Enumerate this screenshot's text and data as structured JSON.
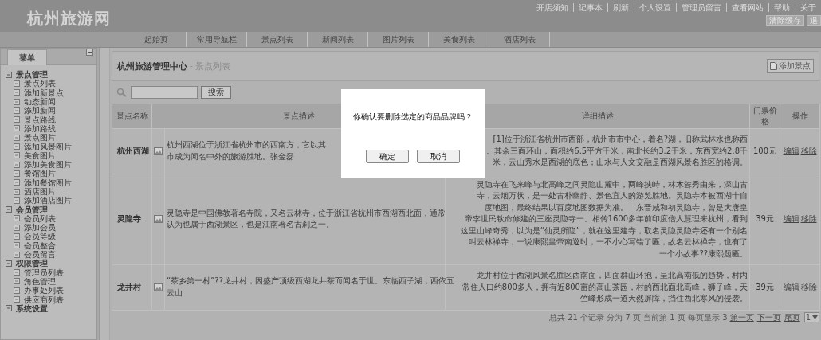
{
  "site": {
    "logo": "杭州旅游网"
  },
  "top_links": [
    "开店须知",
    "记事本",
    "刷新",
    "个人设置",
    "管理员留言",
    "查看网站",
    "帮助",
    "关于"
  ],
  "top_buttons": [
    "清除缓存",
    "退"
  ],
  "nav_tabs": [
    "起始页",
    "常用导航栏",
    "景点列表",
    "新闻列表",
    "图片列表",
    "美食列表",
    "酒店列表"
  ],
  "sidebar": {
    "tab": "菜单",
    "groups": [
      {
        "label": "景点管理",
        "expanded": true,
        "children": [
          {
            "label": "景点列表"
          },
          {
            "label": "添加新景点"
          },
          {
            "label": "动态新闻"
          },
          {
            "label": "添加新闻"
          },
          {
            "label": "景点路线"
          },
          {
            "label": "添加路线"
          },
          {
            "label": "景点图片"
          },
          {
            "label": "添加风景图片"
          },
          {
            "label": "美食图片"
          },
          {
            "label": "添加美食图片"
          },
          {
            "label": "餐馆图片"
          },
          {
            "label": "添加餐馆图片"
          },
          {
            "label": "酒店图片"
          },
          {
            "label": "添加酒店图片"
          }
        ]
      },
      {
        "label": "会员管理",
        "expanded": true,
        "children": [
          {
            "label": "会员列表"
          },
          {
            "label": "添加会员"
          },
          {
            "label": "会员等级"
          },
          {
            "label": "会员整合"
          },
          {
            "label": "会员留言"
          }
        ]
      },
      {
        "label": "权限管理",
        "expanded": true,
        "children": [
          {
            "label": "管理员列表"
          },
          {
            "label": "角色管理"
          },
          {
            "label": "办事处列表"
          },
          {
            "label": "供应商列表"
          }
        ]
      },
      {
        "label": "系统设置",
        "expanded": true
      }
    ]
  },
  "breadcrumb": {
    "title": "杭州旅游管理中心",
    "separator": "-",
    "current": "景点列表"
  },
  "add_button": "添加景点",
  "search": {
    "button": "搜索"
  },
  "table": {
    "columns": [
      "景点名称",
      "景点描述",
      "详细描述",
      "门票价格",
      "操作"
    ],
    "rows": [
      {
        "name": "杭州西湖",
        "description": [
          "杭州西湖位于浙江省杭州市的西南方，它以其",
          "市成为闻名中外的旅游胜地。张金磊"
        ],
        "details": [
          "[1]位于浙江省杭州市西部，杭州市市中心，着名?湖，旧称武林水也称西",
          "。其余三面环山，面积约6.5平方千米，南北长约3.2千米，东西宽约2.8千",
          "米，云山秀水是西湖的底色；山水与人文交融是西湖风景名胜区的格调。"
        ],
        "price": "100元",
        "actions": [
          "编辑",
          "移除"
        ]
      },
      {
        "name": "灵隐寺",
        "description": [
          "灵隐寺是中国佛教著名寺院，又名云林寺，位于浙江省杭州市西湖西北面，通常",
          "认为也属于西湖景区，也是江南著名古刹之一。"
        ],
        "details": [
          "灵隐寺在飞来峰与北高峰之间灵隐山麓中，两峰挟峙，林木耸秀由来，深山古",
          "寺，云烟万状，是一处古朴幽静、景色宜人的游览胜地。灵隐寺本被西湖十自",
          "度地图，最终结果以百度地图数据为准。　东晋咸和初灵隐寺，曾是大唐皇",
          "帝李世民钦命修建的三座灵隐寺一。相传1600多年前印度僧人慧理来杭州，看到",
          "这里山峰奇秀，以为是“仙灵所隐”，就在这里建寺，取名灵隐灵隐寺还有一个别名",
          "叫云林禅寺，一说康熙皇帝南巡时，一不小心写错了匾，故名云林禅寺，也有了",
          "一个小故事??康熙题匾。"
        ],
        "price": "39元",
        "actions": [
          "编辑",
          "移除"
        ]
      },
      {
        "name": "龙井村",
        "description": [
          "“茶乡第一村”??龙井村，因盛产顶级西湖龙井茶而闻名于世。东临西子湖，西依五",
          "云山"
        ],
        "details": [
          "龙井村位于西湖风景名胜区西南面，四面群山环抱，呈北高南低的趋势，村内",
          "常住人口约800多人，拥有近800亩的高山茶园，村的西北面北高峰，狮子峰，天",
          "竺峰形成一道天然屏障，挡住西北寒风的侵袭。"
        ],
        "price": "39元",
        "actions": [
          "编辑",
          "移除"
        ]
      }
    ]
  },
  "pager": {
    "summary": "总共 21 个记录 分为 7 页 当前第 1 页 每页显示 3",
    "links": [
      "第一页",
      "下一页",
      "尾页"
    ],
    "page": "1"
  },
  "dialog": {
    "message": "你确认要删除选定的商品品牌吗？",
    "buttons": [
      "确定",
      "取消"
    ]
  }
}
